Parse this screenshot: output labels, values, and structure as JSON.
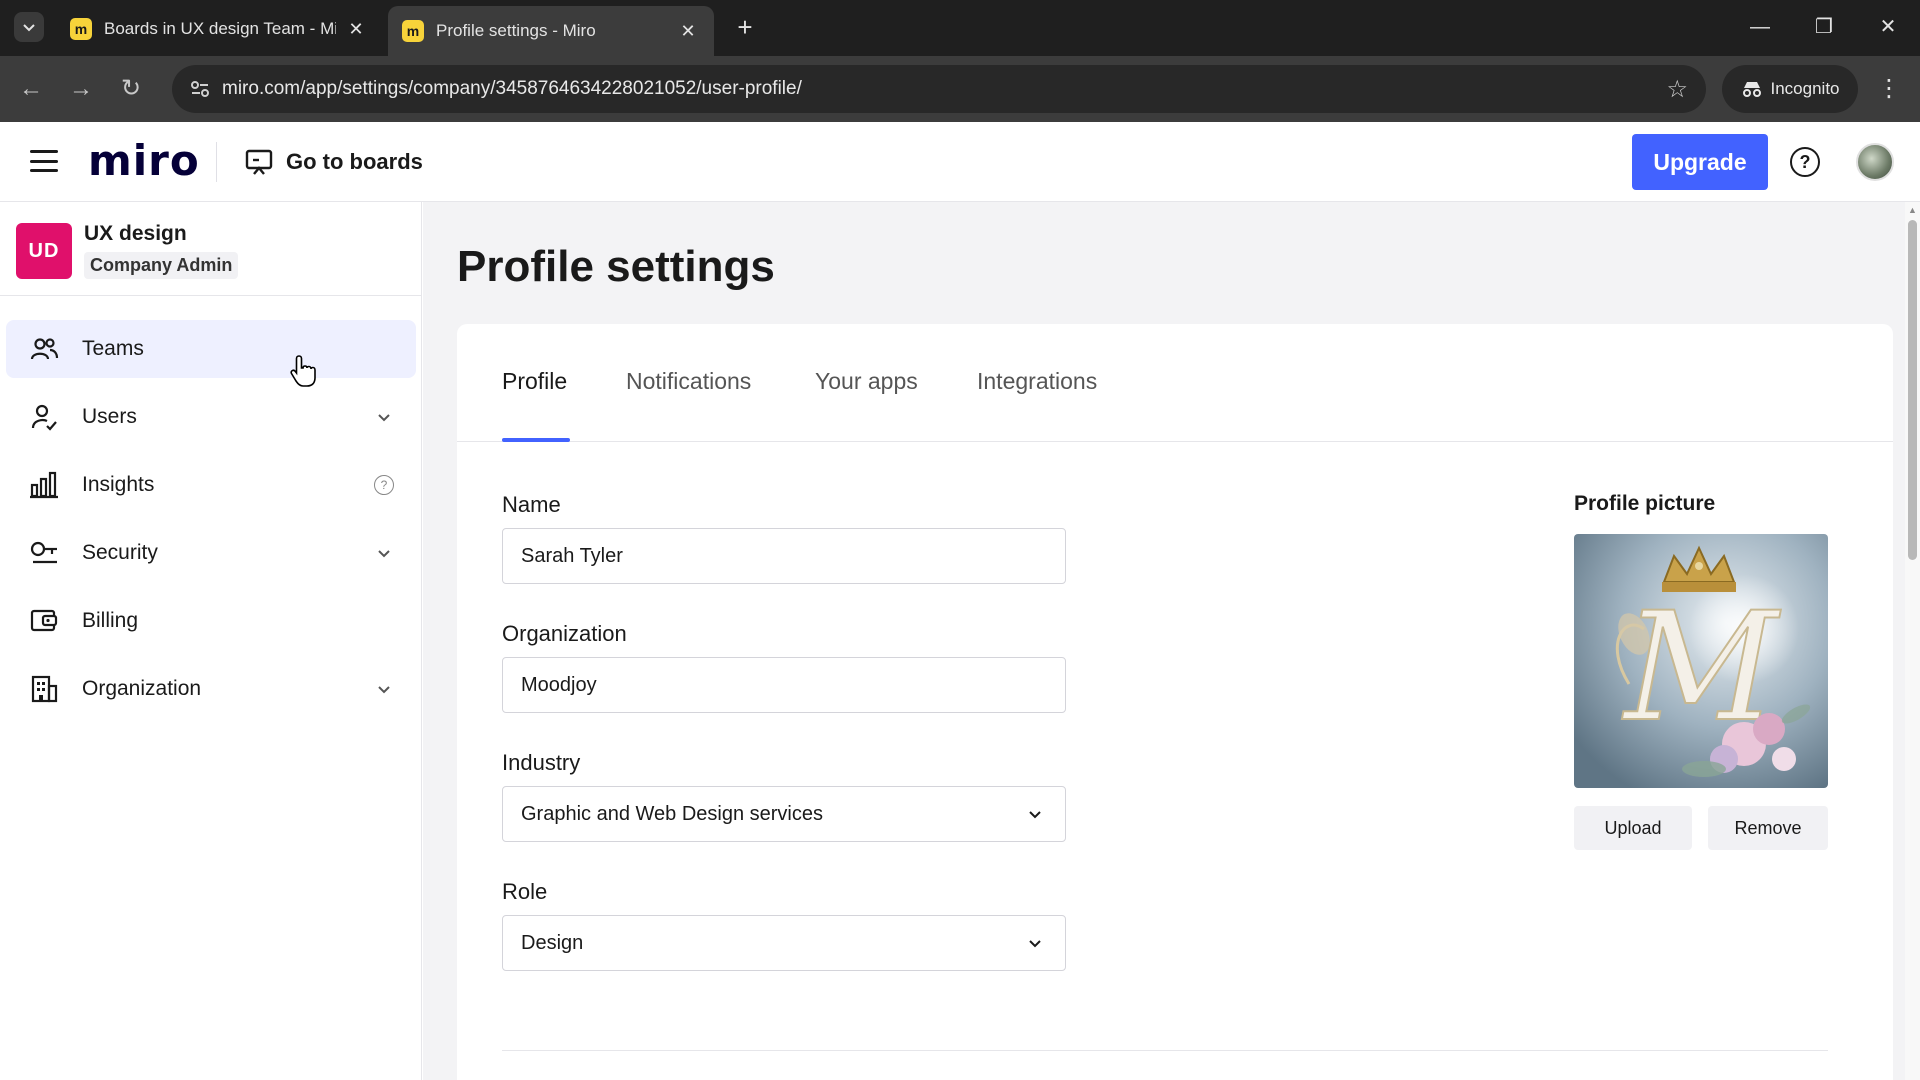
{
  "browser": {
    "tabs": [
      {
        "title": "Boards in UX design Team - Miro",
        "favicon": "m"
      },
      {
        "title": "Profile settings - Miro",
        "favicon": "m"
      }
    ],
    "url": "miro.com/app/settings/company/3458764634228021052/user-profile/",
    "incognito_label": "Incognito"
  },
  "header": {
    "logo": "miro",
    "go_to_boards": "Go to boards",
    "upgrade_label": "Upgrade",
    "help_symbol": "?"
  },
  "sidebar": {
    "org_badge": "UD",
    "org_name": "UX design",
    "org_role": "Company Admin",
    "items": [
      {
        "label": "Teams",
        "icon": "teams-icon",
        "active": true
      },
      {
        "label": "Users",
        "icon": "user-icon",
        "expandable": true
      },
      {
        "label": "Insights",
        "icon": "bar-chart-icon",
        "info": "?"
      },
      {
        "label": "Security",
        "icon": "key-icon",
        "expandable": true
      },
      {
        "label": "Billing",
        "icon": "wallet-icon"
      },
      {
        "label": "Organization",
        "icon": "building-icon",
        "expandable": true
      }
    ]
  },
  "main": {
    "title": "Profile settings",
    "tabs": [
      "Profile",
      "Notifications",
      "Your apps",
      "Integrations"
    ],
    "selected_tab": "Profile",
    "fields": {
      "name_label": "Name",
      "name_value": "Sarah Tyler",
      "org_label": "Organization",
      "org_value": "Moodjoy",
      "industry_label": "Industry",
      "industry_value": "Graphic and Web Design services",
      "role_label": "Role",
      "role_value": "Design"
    },
    "profile_picture": {
      "title": "Profile picture",
      "letter": "M",
      "upload_label": "Upload",
      "remove_label": "Remove"
    }
  },
  "colors": {
    "accent": "#4262ff",
    "org_badge": "#e0106b",
    "active_nav": "#eef0ff"
  }
}
